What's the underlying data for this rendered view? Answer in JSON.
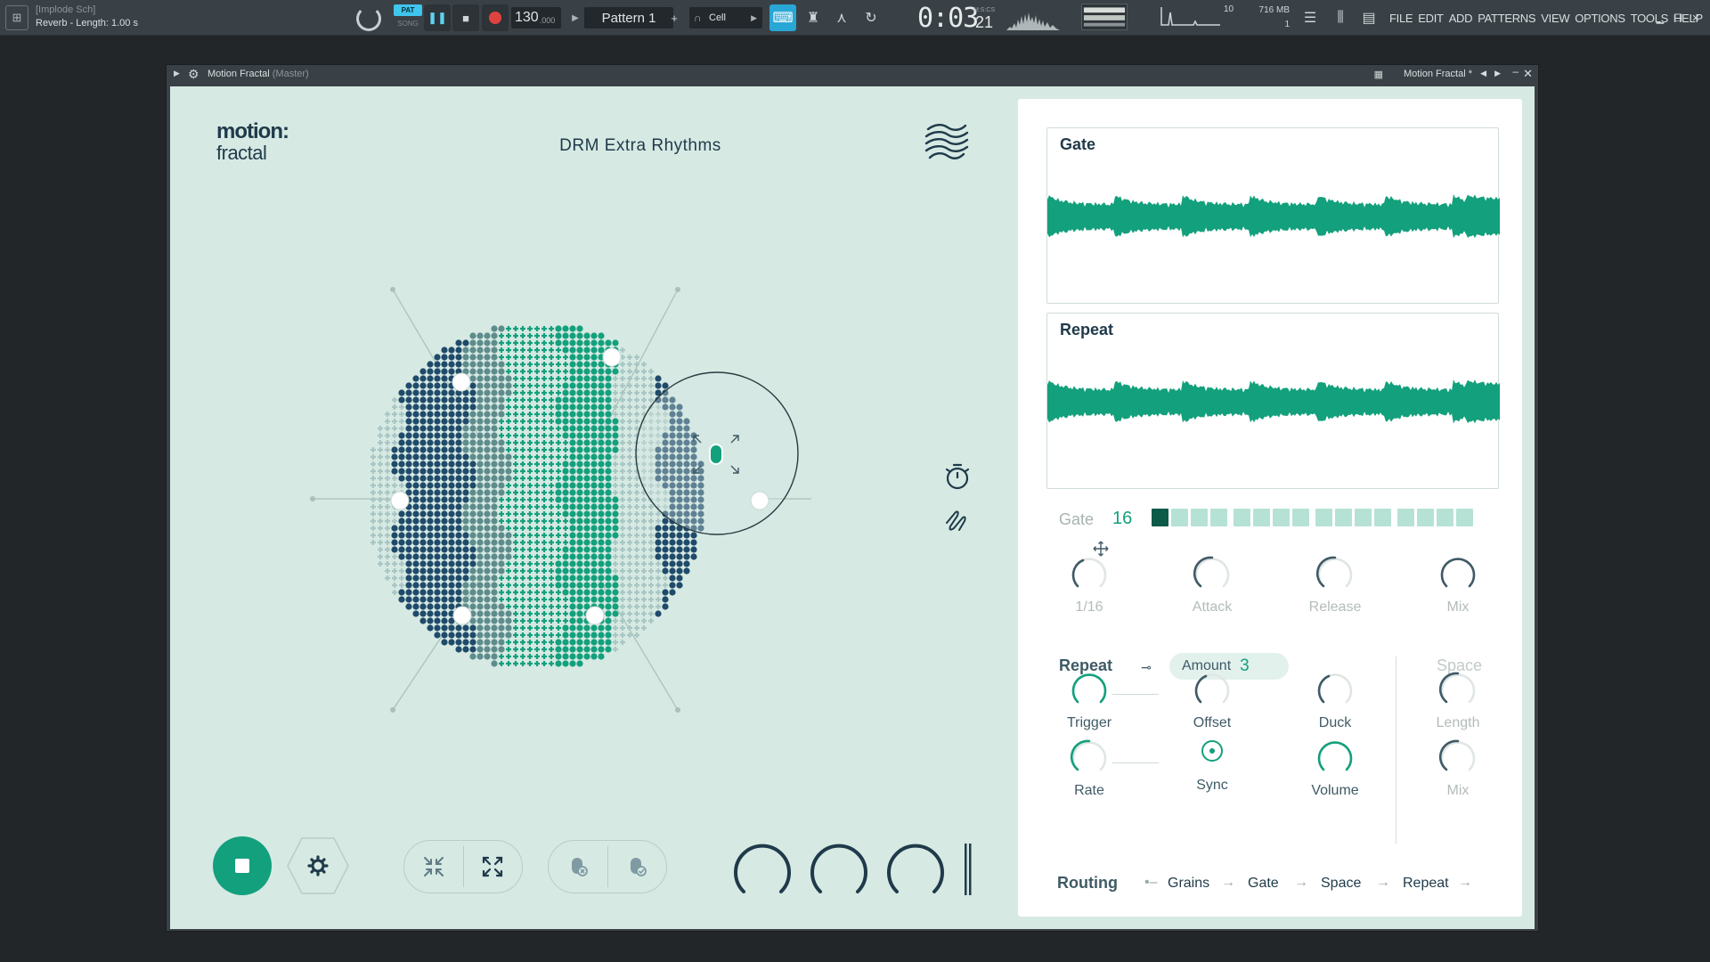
{
  "toolbar": {
    "hint_line1": "[Implode Sch]",
    "hint_line2": "Reverb - Length: 1.00 s",
    "pat_label": "PAT",
    "song_label": "SONG",
    "tempo_main": "130",
    "tempo_frac": ".000",
    "pattern": "Pattern 1",
    "snap": "Cell",
    "clock_main": "0:03",
    "clock_unit": "M:S:CS",
    "clock_secs": "21",
    "cpu_value": "10",
    "mem_value": "716 MB",
    "voices": "1",
    "menu": [
      "FILE",
      "EDIT",
      "ADD",
      "PATTERNS",
      "VIEW",
      "OPTIONS",
      "TOOLS",
      "HELP"
    ]
  },
  "plugin_window": {
    "title": "Motion Fractal",
    "subtitle": "(Master)",
    "preset_name": "Motion Fractal *"
  },
  "plugin": {
    "logo_line1": "motion:",
    "logo_line2": "fractal",
    "preset": "DRM Extra Rhythms",
    "colors": {
      "accent": "#13a07c",
      "dark": "#1f4a6a",
      "mid": "#5e8c8c",
      "light": "#a9c6c4",
      "bg": "#d6e9e3"
    },
    "panel": {
      "gate_title": "Gate",
      "repeat_title": "Repeat",
      "gate_label": "Gate",
      "gate_steps": "16",
      "gate_pattern": [
        1,
        0,
        0,
        0,
        0,
        0,
        0,
        0,
        0,
        0,
        0,
        0,
        0,
        0,
        0,
        0
      ],
      "gate_knobs": [
        "1/16",
        "Attack",
        "Release",
        "Mix"
      ],
      "repeat_label": "Repeat",
      "amount_label": "Amount",
      "amount_value": "3",
      "space_label": "Space",
      "repeat_knobs": [
        "Trigger",
        "Offset",
        "Duck",
        "Length"
      ],
      "repeat_knobs2": [
        "Rate",
        "Sync",
        "Volume",
        "Mix"
      ],
      "routing_label": "Routing",
      "routing": [
        "Grains",
        "Gate",
        "Space",
        "Repeat"
      ]
    }
  }
}
